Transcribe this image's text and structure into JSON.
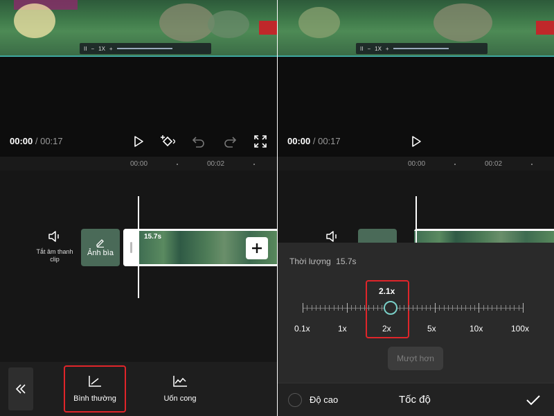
{
  "left": {
    "time": {
      "current": "00:00",
      "total": "/ 00:17"
    },
    "ruler": {
      "t0": "00:00",
      "t1": "00:02"
    },
    "mute": {
      "label": "Tắt âm thanh clip"
    },
    "cover": {
      "label": "Ảnh bìa"
    },
    "clip": {
      "duration": "15.7s"
    },
    "toolbar": {
      "normal_label": "Bình thường",
      "curve_label": "Uốn cong"
    }
  },
  "right": {
    "time": {
      "current": "00:00",
      "total": "/ 00:17"
    },
    "ruler": {
      "t0": "00:00",
      "t1": "00:02"
    },
    "speed_sheet": {
      "duration_label": "Thời lượng",
      "duration_value": "15.7s",
      "current_speed": "2.1x",
      "current_speed_value": 2.1,
      "scale_labels": [
        "0.1x",
        "1x",
        "2x",
        "5x",
        "10x",
        "100x"
      ],
      "smooth_label": "Mượt hơn",
      "height_label": "Độ cao",
      "title": "Tốc độ"
    }
  },
  "colors": {
    "highlight": "#e0252a",
    "accent": "#7ad0c8",
    "panel": "#0d0d0d",
    "sheet": "#2a2a2a"
  }
}
